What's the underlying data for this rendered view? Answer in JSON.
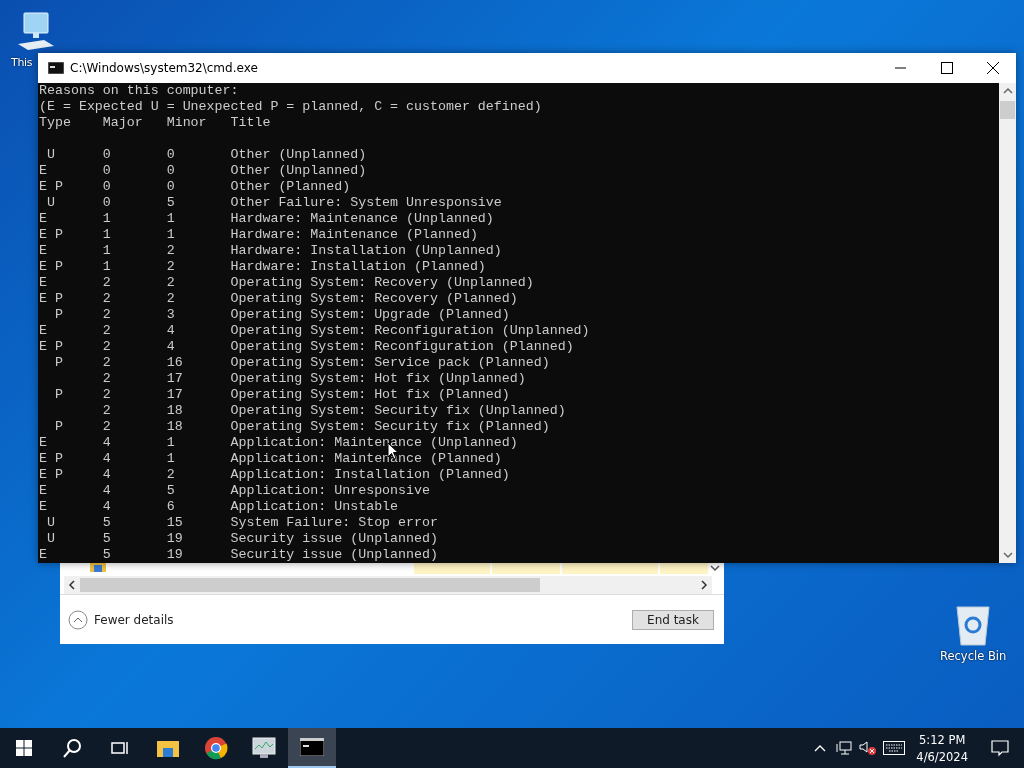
{
  "desktop_icons": [
    {
      "label": "This"
    },
    {
      "label": "Recycle Bin"
    }
  ],
  "task_manager": {
    "fewer_details": "Fewer details",
    "end_task": "End task"
  },
  "window": {
    "title": "C:\\Windows\\system32\\cmd.exe"
  },
  "console": {
    "intro": [
      "Reasons on this computer:",
      "(E = Expected U = Unexpected P = planned, C = customer defined)"
    ],
    "columns": "Type    Major   Minor   Title",
    "rows": [
      " U      0       0       Other (Unplanned)",
      "E       0       0       Other (Unplanned)",
      "E P     0       0       Other (Planned)",
      " U      0       5       Other Failure: System Unresponsive",
      "E       1       1       Hardware: Maintenance (Unplanned)",
      "E P     1       1       Hardware: Maintenance (Planned)",
      "E       1       2       Hardware: Installation (Unplanned)",
      "E P     1       2       Hardware: Installation (Planned)",
      "E       2       2       Operating System: Recovery (Unplanned)",
      "E P     2       2       Operating System: Recovery (Planned)",
      "  P     2       3       Operating System: Upgrade (Planned)",
      "E       2       4       Operating System: Reconfiguration (Unplanned)",
      "E P     2       4       Operating System: Reconfiguration (Planned)",
      "  P     2       16      Operating System: Service pack (Planned)",
      "        2       17      Operating System: Hot fix (Unplanned)",
      "  P     2       17      Operating System: Hot fix (Planned)",
      "        2       18      Operating System: Security fix (Unplanned)",
      "  P     2       18      Operating System: Security fix (Planned)",
      "E       4       1       Application: Maintenance (Unplanned)",
      "E P     4       1       Application: Maintenance (Planned)",
      "E P     4       2       Application: Installation (Planned)",
      "E       4       5       Application: Unresponsive",
      "E       4       6       Application: Unstable",
      " U      5       15      System Failure: Stop error",
      " U      5       19      Security issue (Unplanned)",
      "E       5       19      Security issue (Unplanned)"
    ]
  },
  "taskbar": {
    "apps": [
      {
        "kind": "explorer",
        "selected": false
      },
      {
        "kind": "chrome",
        "selected": false
      },
      {
        "kind": "taskmgr",
        "selected": false
      },
      {
        "kind": "cmd",
        "selected": true
      }
    ]
  },
  "clock": {
    "time": "5:12 PM",
    "date": "4/6/2024"
  }
}
